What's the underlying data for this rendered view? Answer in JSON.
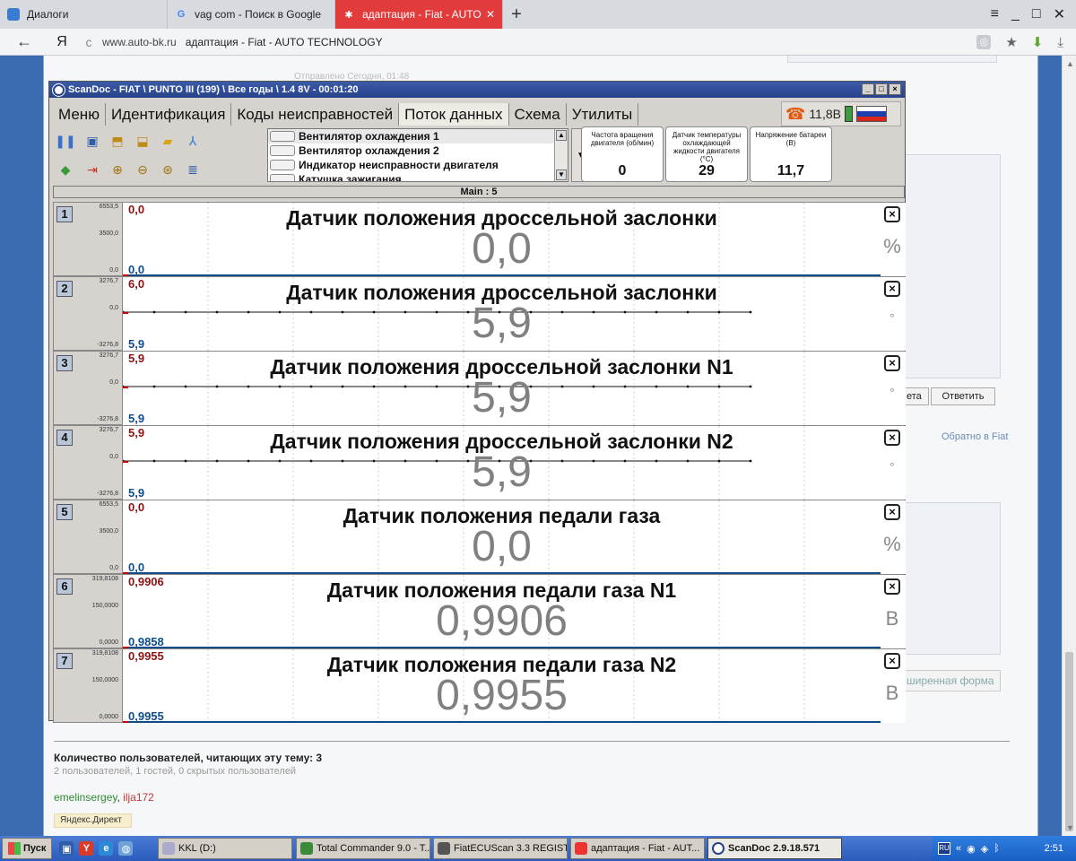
{
  "browser": {
    "tabs": [
      {
        "title": "Диалоги",
        "icon": "dialog-icon"
      },
      {
        "title": "vag com - Поиск в Google",
        "icon": "google-icon",
        "icon_glyph": "G"
      },
      {
        "title": "адаптация - Fiat - AUTO",
        "icon": "forum-icon",
        "active": true
      }
    ],
    "new_tab": "+",
    "controls": {
      "menu": "≡",
      "minimize": "_",
      "maximize": "□",
      "close": "✕"
    },
    "address": {
      "back": "←",
      "brand": "Я",
      "reload": "c",
      "domain": "www.auto-bk.ru",
      "title": "адаптация - Fiat - AUTO TECHNOLOGY"
    }
  },
  "webpage": {
    "reply_partial": "ета",
    "reply": "Ответить",
    "back_link": "Обратно в Fiat",
    "extended_form": "ширенная форма",
    "users_title": "Количество пользователей, читающих эту тему: 3",
    "users_sub": "2 пользователей, 1 гостей, 0 скрытых пользователей",
    "user1": "emelinsergey",
    "separator": ", ",
    "user2": "ilja172",
    "yandex": "Яндекс.Директ",
    "faded_text": "Отправлено Сегодня, 01:48"
  },
  "scandoc": {
    "title": "ScanDoc - FIAT \\ PUNTO III (199) \\ Все годы \\ 1.4 8V - 00:01:20",
    "window_buttons": [
      "_",
      "□",
      "×"
    ],
    "menu": [
      {
        "label": "Меню"
      },
      {
        "label": "Идентификация"
      },
      {
        "label": "Коды неисправностей"
      },
      {
        "label": "Поток данных",
        "active": true
      },
      {
        "label": "Схема"
      },
      {
        "label": "Утилиты"
      }
    ],
    "status": {
      "voltage": "11,8В"
    },
    "signals": [
      {
        "label": "Вентилятор охлаждения 1",
        "selected": true
      },
      {
        "label": "Вентилятор охлаждения 2"
      },
      {
        "label": "Индикатор неисправности двигателя"
      },
      {
        "label": "Катушка зажигания"
      }
    ],
    "more": "...",
    "gauges": [
      {
        "label": "Частота вращения двигателя (об/мин)",
        "value": "0"
      },
      {
        "label": "Датчик температуры охлаждающей жидкости двигателя (°C)",
        "value": "29"
      },
      {
        "label": "Напряжение батареи (В)",
        "value": "11,7"
      }
    ],
    "main_label": "Main : 5",
    "charts": [
      {
        "num": "1",
        "ymax": "6553,5",
        "ymid": "3500,0",
        "ymin": "0,0",
        "cur_top": "0,0",
        "cur_bottom": "0,0",
        "title": "Датчик положения дроссельной заслонки",
        "value": "0,0",
        "unit": "%",
        "line": false
      },
      {
        "num": "2",
        "ymax": "3276,7",
        "ymid": "0,0",
        "ymin": "-3276,8",
        "cur_top": "6,0",
        "cur_bottom": "5,9",
        "title": "Датчик положения дроссельной заслонки",
        "value": "5,9",
        "unit": "°",
        "line": true
      },
      {
        "num": "3",
        "ymax": "3276,7",
        "ymid": "0,0",
        "ymin": "-3276,8",
        "cur_top": "5,9",
        "cur_bottom": "5,9",
        "title": "Датчик положения дроссельной заслонки N1",
        "value": "5,9",
        "unit": "°",
        "line": true
      },
      {
        "num": "4",
        "ymax": "3276,7",
        "ymid": "0,0",
        "ymin": "-3276,8",
        "cur_top": "5,9",
        "cur_bottom": "5,9",
        "title": "Датчик положения дроссельной заслонки N2",
        "value": "5,9",
        "unit": "°",
        "line": true
      },
      {
        "num": "5",
        "ymax": "6553,5",
        "ymid": "3500,0",
        "ymin": "0,0",
        "cur_top": "0,0",
        "cur_bottom": "0,0",
        "title": "Датчик положения педали газа",
        "value": "0,0",
        "unit": "%",
        "line": false
      },
      {
        "num": "6",
        "ymax": "319,8108",
        "ymid": "150,0000",
        "ymin": "0,0000",
        "cur_top": "0,9906",
        "cur_bottom": "0,9858",
        "title": "Датчик положения педали газа N1",
        "value": "0,9906",
        "unit": "В",
        "line": false
      },
      {
        "num": "7",
        "ymax": "319,8108",
        "ymid": "150,0000",
        "ymin": "0,0000",
        "cur_top": "0,9955",
        "cur_bottom": "0,9955",
        "title": "Датчик положения педали газа N2",
        "value": "0,9955",
        "unit": "В",
        "line": false
      }
    ],
    "close_glyph": "×"
  },
  "taskbar": {
    "start": "Пуск",
    "tasks": [
      {
        "label": "KKL (D:)"
      },
      {
        "label": "Total Commander 9.0 - T..."
      },
      {
        "label": "FiatECUScan 3.3 REGIST..."
      },
      {
        "label": "адаптация - Fiat - AUT..."
      },
      {
        "label": "ScanDoc 2.9.18.571",
        "active": true
      }
    ],
    "lang": "RU",
    "clock": "2:51"
  },
  "colors": {
    "accent_tab": "#e23b3b",
    "curve_red": "#8a1414",
    "curve_blue": "#0f4d8a"
  }
}
